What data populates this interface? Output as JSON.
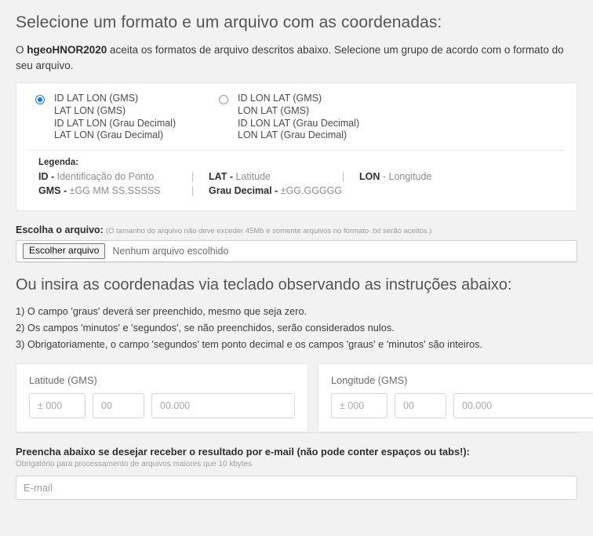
{
  "format_section": {
    "title": "Selecione um formato e um arquivo com as coordenadas:",
    "intro_prefix": "O ",
    "intro_app_name": "hgeoHNOR2020",
    "intro_suffix": " aceita os formatos de arquivo descritos abaixo. Selecione um grupo de acordo com o formato do seu arquivo.",
    "options": [
      {
        "id": "group-lat-lon",
        "selected": true,
        "lines": [
          "ID LAT LON (GMS)",
          "LAT LON (GMS)",
          "ID LAT LON (Grau Decimal)",
          "LAT LON (Grau Decimal)"
        ]
      },
      {
        "id": "group-lon-lat",
        "selected": false,
        "lines": [
          "ID LON LAT (GMS)",
          "LON LAT (GMS)",
          "ID LON LAT (Grau Decimal)",
          "LON LAT (Grau Decimal)"
        ]
      }
    ],
    "legend": {
      "title": "Legenda:",
      "separator": "|",
      "row1": [
        {
          "key": "ID -",
          "value": " Identificação do Ponto"
        },
        {
          "key": "LAT -",
          "value": " Latitude"
        },
        {
          "key": "LON",
          "value": " - Longitude"
        }
      ],
      "row2": [
        {
          "key": "GMS -",
          "value": " ±GG MM SS.SSSSS"
        },
        {
          "key": "Grau Decimal -",
          "value": " ±GG.GGGGG"
        }
      ]
    }
  },
  "file_section": {
    "label": "Escolha o arquivo:",
    "hint": "(O tamanho do arquivo não deve exceder 45Mb e somente arquivos no formato .txt serão aceitos.)",
    "button_label": "Escolher arquivo",
    "status": "Nenhum arquivo escolhido"
  },
  "manual_section": {
    "title": "Ou insira as coordenadas via teclado observando as instruções abaixo:",
    "notes": [
      "1) O campo 'graus' deverá ser preenchido, mesmo que seja zero.",
      "2) Os campos 'minutos' e 'segundos', se não preenchidos, serão considerados nulos.",
      "3) Obrigatoriamente, o campo 'segundos' tem ponto decimal e os campos 'graus' e 'minutos' são inteiros."
    ],
    "cards": [
      {
        "title": "Latitude (GMS)",
        "degrees": {
          "placeholder": "± 000",
          "value": ""
        },
        "minutes": {
          "placeholder": "00",
          "value": ""
        },
        "seconds": {
          "placeholder": "00.000",
          "value": ""
        }
      },
      {
        "title": "Longitude (GMS)",
        "degrees": {
          "placeholder": "± 000",
          "value": ""
        },
        "minutes": {
          "placeholder": "00",
          "value": ""
        },
        "seconds": {
          "placeholder": "00.000",
          "value": ""
        }
      }
    ]
  },
  "email_section": {
    "title": "Preencha abaixo se desejar receber o resultado por e-mail (não pode conter espaços ou tabs!):",
    "subtitle": "Obrigatório para processamento de arquivos maiores que 10 kbytes",
    "placeholder": "E-mail",
    "value": ""
  },
  "colors": {
    "page_background": "#f2f2f2",
    "card_background": "#ffffff",
    "accent_radio": "#1a73e8",
    "heading_text": "#555555",
    "body_text": "#3c3c3c",
    "muted_text": "#9b9b9b",
    "border": "#e0e0e0"
  }
}
